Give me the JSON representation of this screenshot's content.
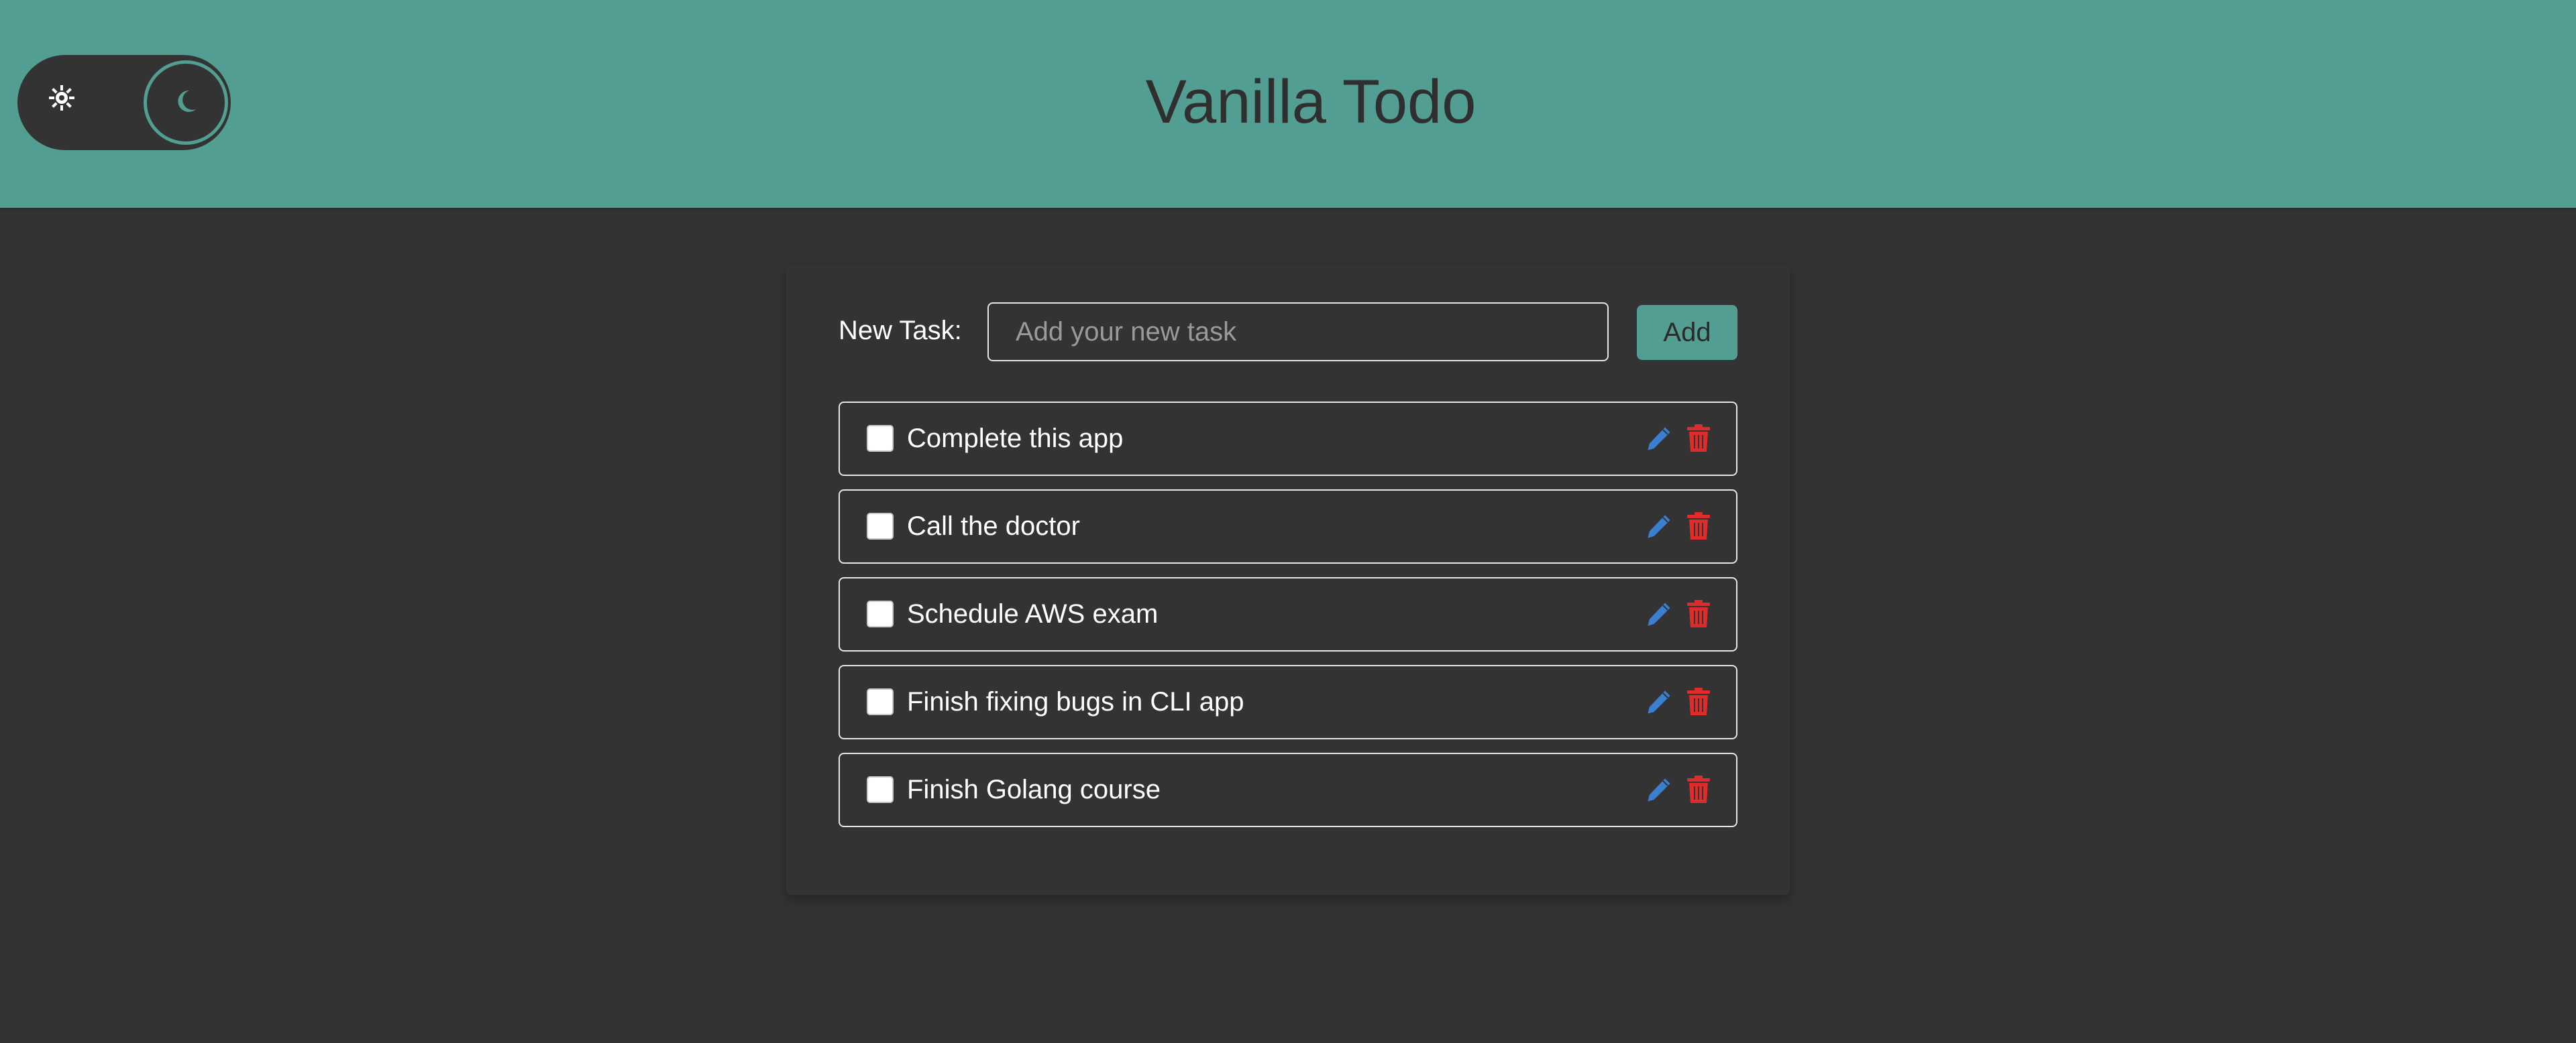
{
  "header": {
    "title": "Vanilla Todo"
  },
  "theme_toggle": {
    "light_icon": "sun-icon",
    "dark_icon": "moon-icon",
    "selected": "dark"
  },
  "form": {
    "label": "New Task:",
    "input_value": "",
    "input_placeholder": "Add your new task",
    "add_label": "Add"
  },
  "tasks": [
    {
      "text": "Complete this app",
      "done": false
    },
    {
      "text": "Call the doctor",
      "done": false
    },
    {
      "text": "Schedule AWS exam",
      "done": false
    },
    {
      "text": "Finish fixing bugs in CLI app",
      "done": false
    },
    {
      "text": "Finish Golang course",
      "done": false
    }
  ],
  "icons": {
    "edit": "pencil-icon",
    "delete": "trash-icon"
  },
  "colors": {
    "header_bg": "#529e92",
    "page_bg": "#333333",
    "accent": "#529e92",
    "edit_icon": "#3b7fd1",
    "delete_icon": "#e02b2b"
  }
}
